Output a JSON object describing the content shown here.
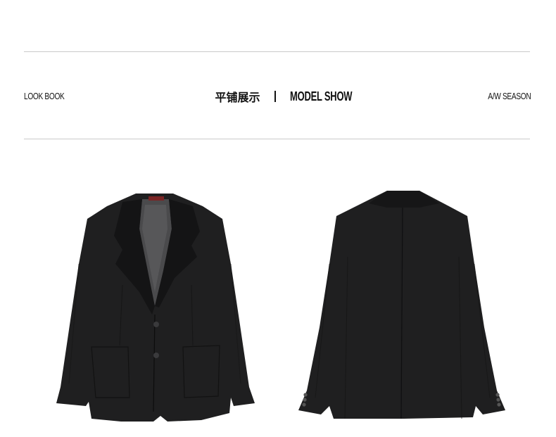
{
  "header": {
    "left_label": "LOOK BOOK",
    "title_cn": "平铺展示",
    "title_en": "MODEL SHOW",
    "right_label": "A/W SEASON"
  },
  "images": [
    {
      "name": "blazer-front",
      "description_kind": "product-photo"
    },
    {
      "name": "blazer-back",
      "description_kind": "product-photo"
    }
  ],
  "colors": {
    "rule": "#c9c9c9",
    "text": "#111111",
    "garment": "#1f1f20",
    "background": "#ffffff"
  }
}
